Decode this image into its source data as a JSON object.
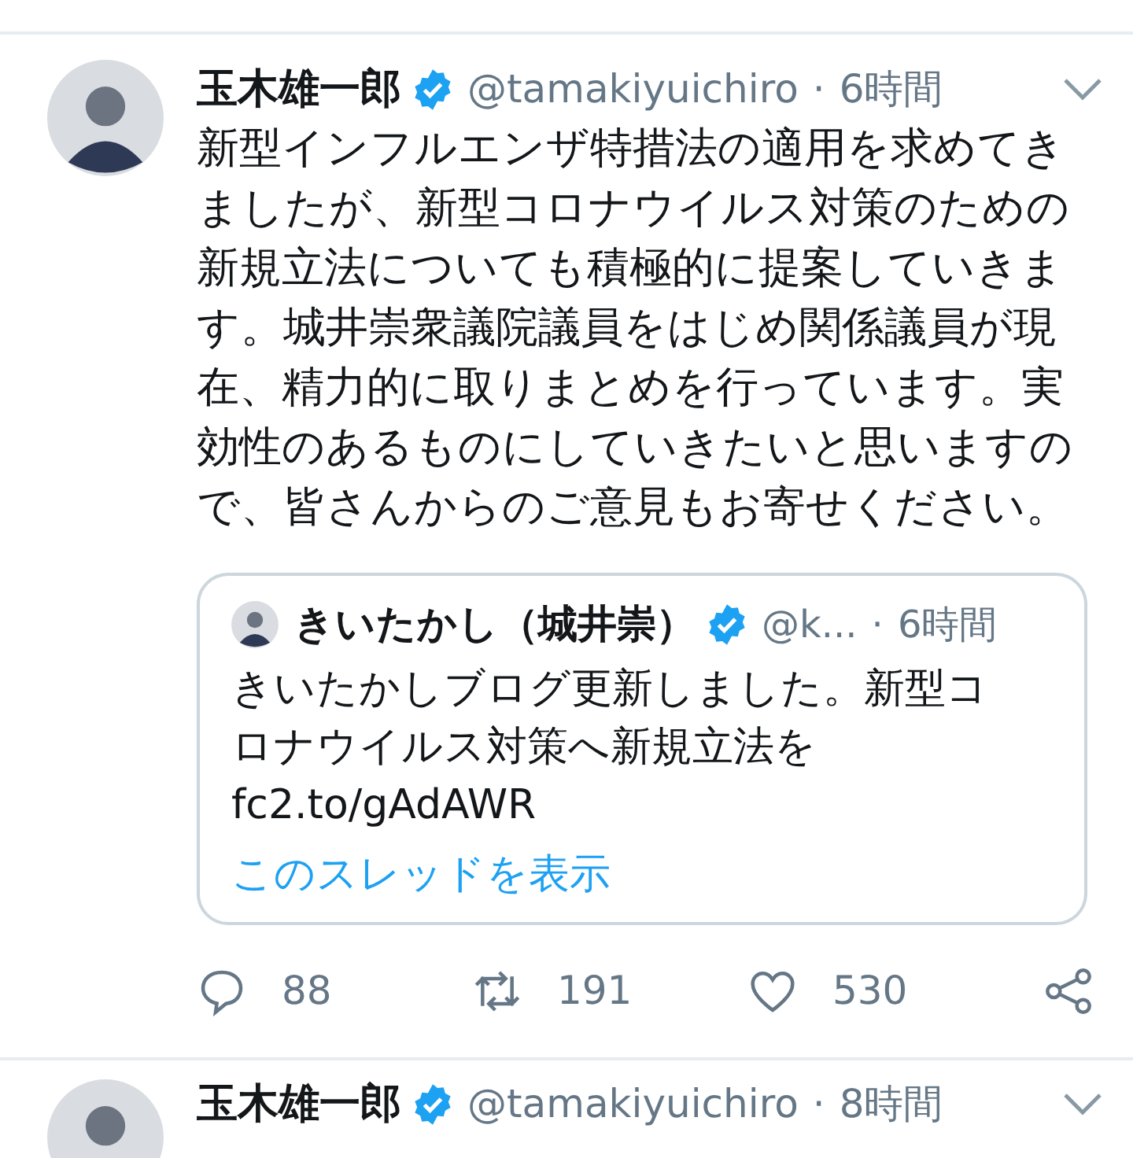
{
  "tweets": [
    {
      "name": "玉木雄一郎",
      "verified": true,
      "handle": "@tamakiyuichiro",
      "separator": "·",
      "time": "6時間",
      "text": "新型インフルエンザ特措法の適用を求めてきましたが、新型コロナウイルス対策のための新規立法についても積極的に提案していきます。城井崇衆議院議員をはじめ関係議員が現在、精力的に取りまとめを行っています。実効性のあるものにしていきたいと思いますので、皆さんからのご意見もお寄せください。",
      "quote": {
        "name": "きいたかし（城井崇）",
        "verified": true,
        "handle": "@k...",
        "separator": "·",
        "time": "6時間",
        "text": "きいたかしブログ更新しました。新型コロナウイルス対策へ新規立法を",
        "link": "fc2.to/gAdAWR",
        "thread_link": "このスレッドを表示"
      },
      "actions": {
        "replies": "88",
        "retweets": "191",
        "likes": "530"
      }
    },
    {
      "name": "玉木雄一郎",
      "verified": true,
      "handle": "@tamakiyuichiro",
      "separator": "·",
      "time": "8時間"
    }
  ]
}
